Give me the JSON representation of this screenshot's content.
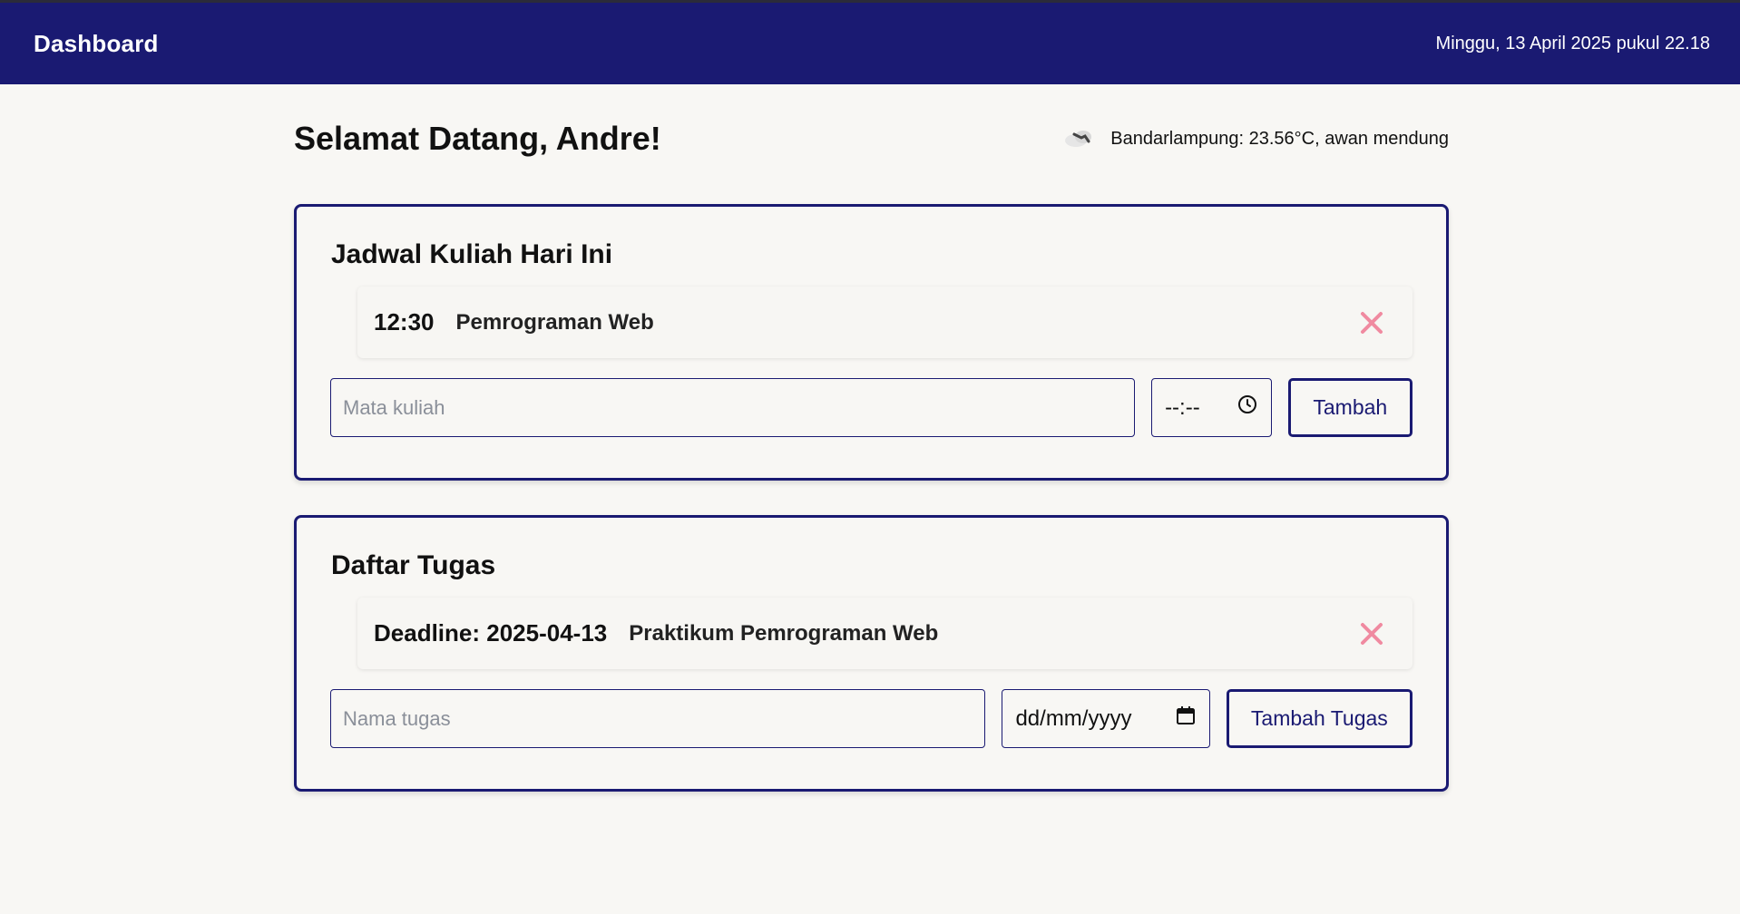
{
  "header": {
    "title": "Dashboard",
    "datetime": "Minggu, 13 April 2025 pukul 22.18"
  },
  "welcome": {
    "greeting": "Selamat Datang, Andre!",
    "weather_icon": "cloud-icon",
    "weather_text": "Bandarlampung: 23.56°C, awan mendung"
  },
  "schedule": {
    "title": "Jadwal Kuliah Hari Ini",
    "items": [
      {
        "time": "12:30",
        "course": "Pemrograman Web"
      }
    ],
    "form": {
      "course_placeholder": "Mata kuliah",
      "time_placeholder": "--:--",
      "submit_label": "Tambah"
    }
  },
  "tasks": {
    "title": "Daftar Tugas",
    "items": [
      {
        "deadline": "Deadline: 2025-04-13",
        "name": "Praktikum Pemrograman Web"
      }
    ],
    "form": {
      "name_placeholder": "Nama tugas",
      "date_placeholder": "dd/mm/yyyy",
      "submit_label": "Tambah Tugas"
    }
  },
  "colors": {
    "primary": "#1a1a72",
    "background": "#f8f7f4",
    "delete": "#f08aa0"
  }
}
